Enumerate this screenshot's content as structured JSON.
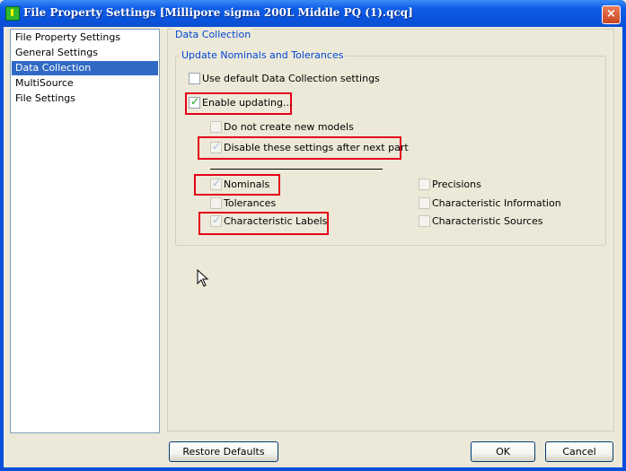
{
  "window": {
    "title": "File Property Settings [Millipore sigma 200L Middle PQ (1).qcq]",
    "close_label": "×"
  },
  "nav": {
    "items": [
      {
        "label": "File Property Settings",
        "selected": false
      },
      {
        "label": "General Settings",
        "selected": false
      },
      {
        "label": "Data Collection",
        "selected": true
      },
      {
        "label": "MultiSource",
        "selected": false
      },
      {
        "label": "File Settings",
        "selected": false
      }
    ]
  },
  "panel": {
    "title": "Data Collection",
    "group_title": "Update Nominals and Tolerances",
    "options": {
      "use_default": {
        "label": "Use default Data Collection settings",
        "checked": false,
        "enabled": true
      },
      "enable_updating": {
        "label": "Enable updating...",
        "checked": true,
        "enabled": true
      },
      "no_new_models": {
        "label": "Do not create new models",
        "checked": false,
        "enabled": false
      },
      "disable_after": {
        "label": "Disable these settings after next part",
        "checked": true,
        "enabled": false
      },
      "nominals": {
        "label": "Nominals",
        "checked": true,
        "enabled": false
      },
      "tolerances": {
        "label": "Tolerances",
        "checked": false,
        "enabled": false
      },
      "char_labels": {
        "label": "Characteristic Labels",
        "checked": true,
        "enabled": false
      },
      "precisions": {
        "label": "Precisions",
        "checked": false,
        "enabled": false
      },
      "char_info": {
        "label": "Characteristic Information",
        "checked": false,
        "enabled": false
      },
      "char_sources": {
        "label": "Characteristic Sources",
        "checked": false,
        "enabled": false
      }
    }
  },
  "buttons": {
    "restore": "Restore Defaults",
    "ok": "OK",
    "cancel": "Cancel"
  },
  "colors": {
    "highlight": "#e4001b",
    "selection": "#316ac5",
    "group_title": "#0046d5"
  }
}
